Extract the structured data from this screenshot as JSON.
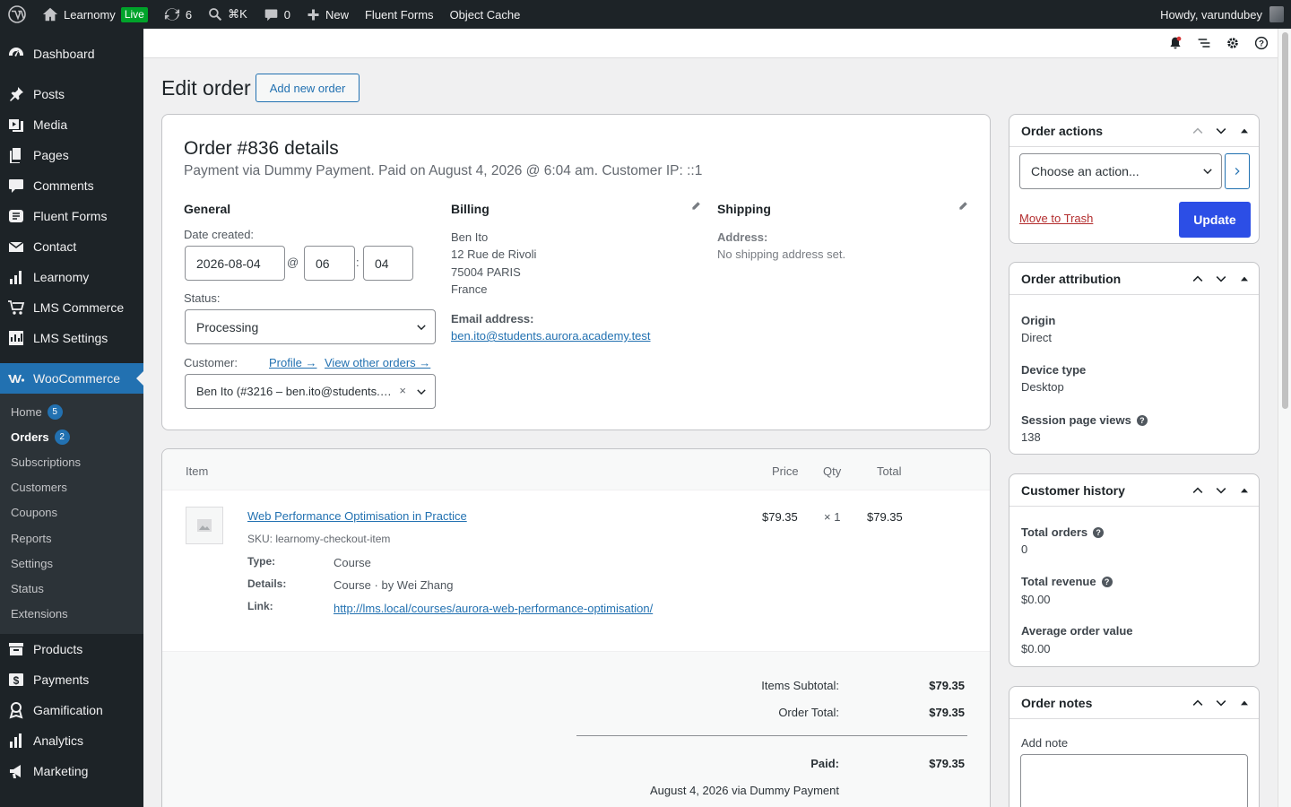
{
  "admin_bar": {
    "site_name": "Learnomy",
    "live_badge": "Live",
    "updates_count": "6",
    "search_shortcut": "⌘K",
    "comments_count": "0",
    "new_label": "New",
    "fluent_forms": "Fluent Forms",
    "object_cache": "Object Cache",
    "howdy": "Howdy, varundubey"
  },
  "sidebar": {
    "items": [
      {
        "label": "Dashboard",
        "icon": "dashboard-icon"
      },
      {
        "label": "Posts",
        "icon": "pin-icon"
      },
      {
        "label": "Media",
        "icon": "media-icon"
      },
      {
        "label": "Pages",
        "icon": "pages-icon"
      },
      {
        "label": "Comments",
        "icon": "comment-icon"
      },
      {
        "label": "Fluent Forms",
        "icon": "forms-icon"
      },
      {
        "label": "Contact",
        "icon": "envelope-icon"
      },
      {
        "label": "Learnomy",
        "icon": "chart-icon"
      },
      {
        "label": "LMS Commerce",
        "icon": "cart-icon"
      },
      {
        "label": "LMS Settings",
        "icon": "settings-chart-icon"
      },
      {
        "label": "WooCommerce",
        "icon": "woo-icon"
      }
    ],
    "submenu": [
      {
        "label": "Home",
        "badge": "5"
      },
      {
        "label": "Orders",
        "badge": "2"
      },
      {
        "label": "Subscriptions"
      },
      {
        "label": "Customers"
      },
      {
        "label": "Coupons"
      },
      {
        "label": "Reports"
      },
      {
        "label": "Settings"
      },
      {
        "label": "Status"
      },
      {
        "label": "Extensions"
      }
    ],
    "items_after": [
      {
        "label": "Products",
        "icon": "archive-icon"
      },
      {
        "label": "Payments",
        "icon": "payments-icon"
      },
      {
        "label": "Gamification",
        "icon": "award-icon"
      },
      {
        "label": "Analytics",
        "icon": "bar-chart-icon"
      },
      {
        "label": "Marketing",
        "icon": "megaphone-icon"
      }
    ]
  },
  "page": {
    "title": "Edit order",
    "add_new": "Add new order"
  },
  "order": {
    "heading": "Order #836 details",
    "meta": "Payment via Dummy Payment. Paid on August 4, 2026 @ 6:04 am. Customer IP: ::1",
    "general": {
      "heading": "General",
      "date_label": "Date created:",
      "date": "2026-08-04",
      "at": "@",
      "hour": "06",
      "colon": ":",
      "minute": "04",
      "status_label": "Status:",
      "status": "Processing",
      "customer_label": "Customer:",
      "profile_link": "Profile →",
      "other_orders_link": "View other orders →",
      "customer": "Ben Ito (#3216 – ben.ito@students.…"
    },
    "billing": {
      "heading": "Billing",
      "name": "Ben Ito",
      "street": "12 Rue de Rivoli",
      "city": "75004 PARIS",
      "country": "France",
      "email_label": "Email address:",
      "email": "ben.ito@students.aurora.academy.test"
    },
    "shipping": {
      "heading": "Shipping",
      "address_label": "Address:",
      "address": "No shipping address set."
    }
  },
  "items": {
    "headers": {
      "item": "Item",
      "price": "Price",
      "qty": "Qty",
      "total": "Total"
    },
    "rows": [
      {
        "name": "Web Performance Optimisation in Practice",
        "sku": "SKU: learnomy-checkout-item",
        "price": "$79.35",
        "qty": "× 1",
        "total": "$79.35",
        "meta": [
          {
            "key": "Type:",
            "value": "Course"
          },
          {
            "key": "Details:",
            "value": "Course · by Wei Zhang"
          },
          {
            "key": "Link:",
            "value": "http://lms.local/courses/aurora-web-performance-optimisation/"
          }
        ]
      }
    ],
    "totals": {
      "subtotal_label": "Items Subtotal:",
      "subtotal": "$79.35",
      "order_total_label": "Order Total:",
      "order_total": "$79.35",
      "paid_label": "Paid:",
      "paid": "$79.35",
      "paid_note": "August 4, 2026 via Dummy Payment"
    }
  },
  "order_actions": {
    "title": "Order actions",
    "select": "Choose an action...",
    "trash": "Move to Trash",
    "update": "Update"
  },
  "attribution": {
    "title": "Order attribution",
    "origin_label": "Origin",
    "origin": "Direct",
    "device_label": "Device type",
    "device": "Desktop",
    "views_label": "Session page views",
    "views": "138"
  },
  "history": {
    "title": "Customer history",
    "orders_label": "Total orders",
    "orders": "0",
    "revenue_label": "Total revenue",
    "revenue": "$0.00",
    "aov_label": "Average order value",
    "aov": "$0.00"
  },
  "notes": {
    "title": "Order notes",
    "add_label": "Add note"
  },
  "colors": {
    "accent": "#2271b1",
    "button": "#2c4ee6",
    "danger": "#b32d2e",
    "sidebar": "#1d2327"
  }
}
